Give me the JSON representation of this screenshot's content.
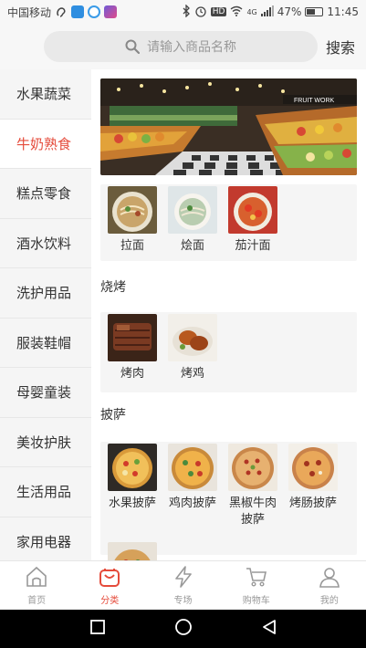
{
  "status_bar": {
    "carrier": "中国移动",
    "hd_label": "HD",
    "signal_label": "4G",
    "battery": "47%",
    "time": "11:45"
  },
  "search": {
    "placeholder": "请输入商品名称",
    "button_label": "搜索"
  },
  "sidebar": {
    "items": [
      {
        "label": "水果蔬菜"
      },
      {
        "label": "牛奶熟食"
      },
      {
        "label": "糕点零食"
      },
      {
        "label": "酒水饮料"
      },
      {
        "label": "洗护用品"
      },
      {
        "label": "服装鞋帽"
      },
      {
        "label": "母婴童装"
      },
      {
        "label": "美妆护肤"
      },
      {
        "label": "生活用品"
      },
      {
        "label": "家用电器"
      }
    ],
    "active_index": 1
  },
  "content": {
    "banner": {
      "sign_text": "FRUIT WORK"
    },
    "sections": [
      {
        "title": "",
        "products": [
          {
            "name": "拉面"
          },
          {
            "name": "烩面"
          },
          {
            "name": "茄汁面"
          }
        ]
      },
      {
        "title": "烧烤",
        "products": [
          {
            "name": "烤肉"
          },
          {
            "name": "烤鸡"
          }
        ]
      },
      {
        "title": "披萨",
        "products": [
          {
            "name": "水果披萨"
          },
          {
            "name": "鸡肉披萨"
          },
          {
            "name": "黑椒牛肉披萨"
          },
          {
            "name": "烤肠披萨"
          }
        ]
      }
    ]
  },
  "tabbar": {
    "tabs": [
      {
        "label": "首页",
        "icon": "home-icon"
      },
      {
        "label": "分类",
        "icon": "bag-icon"
      },
      {
        "label": "专场",
        "icon": "lightning-icon"
      },
      {
        "label": "购物车",
        "icon": "cart-icon"
      },
      {
        "label": "我的",
        "icon": "user-icon"
      }
    ],
    "active_index": 1
  },
  "colors": {
    "accent": "#e54b3b",
    "sidebar_bg": "#f5f5f5",
    "muted_text": "#999999"
  }
}
